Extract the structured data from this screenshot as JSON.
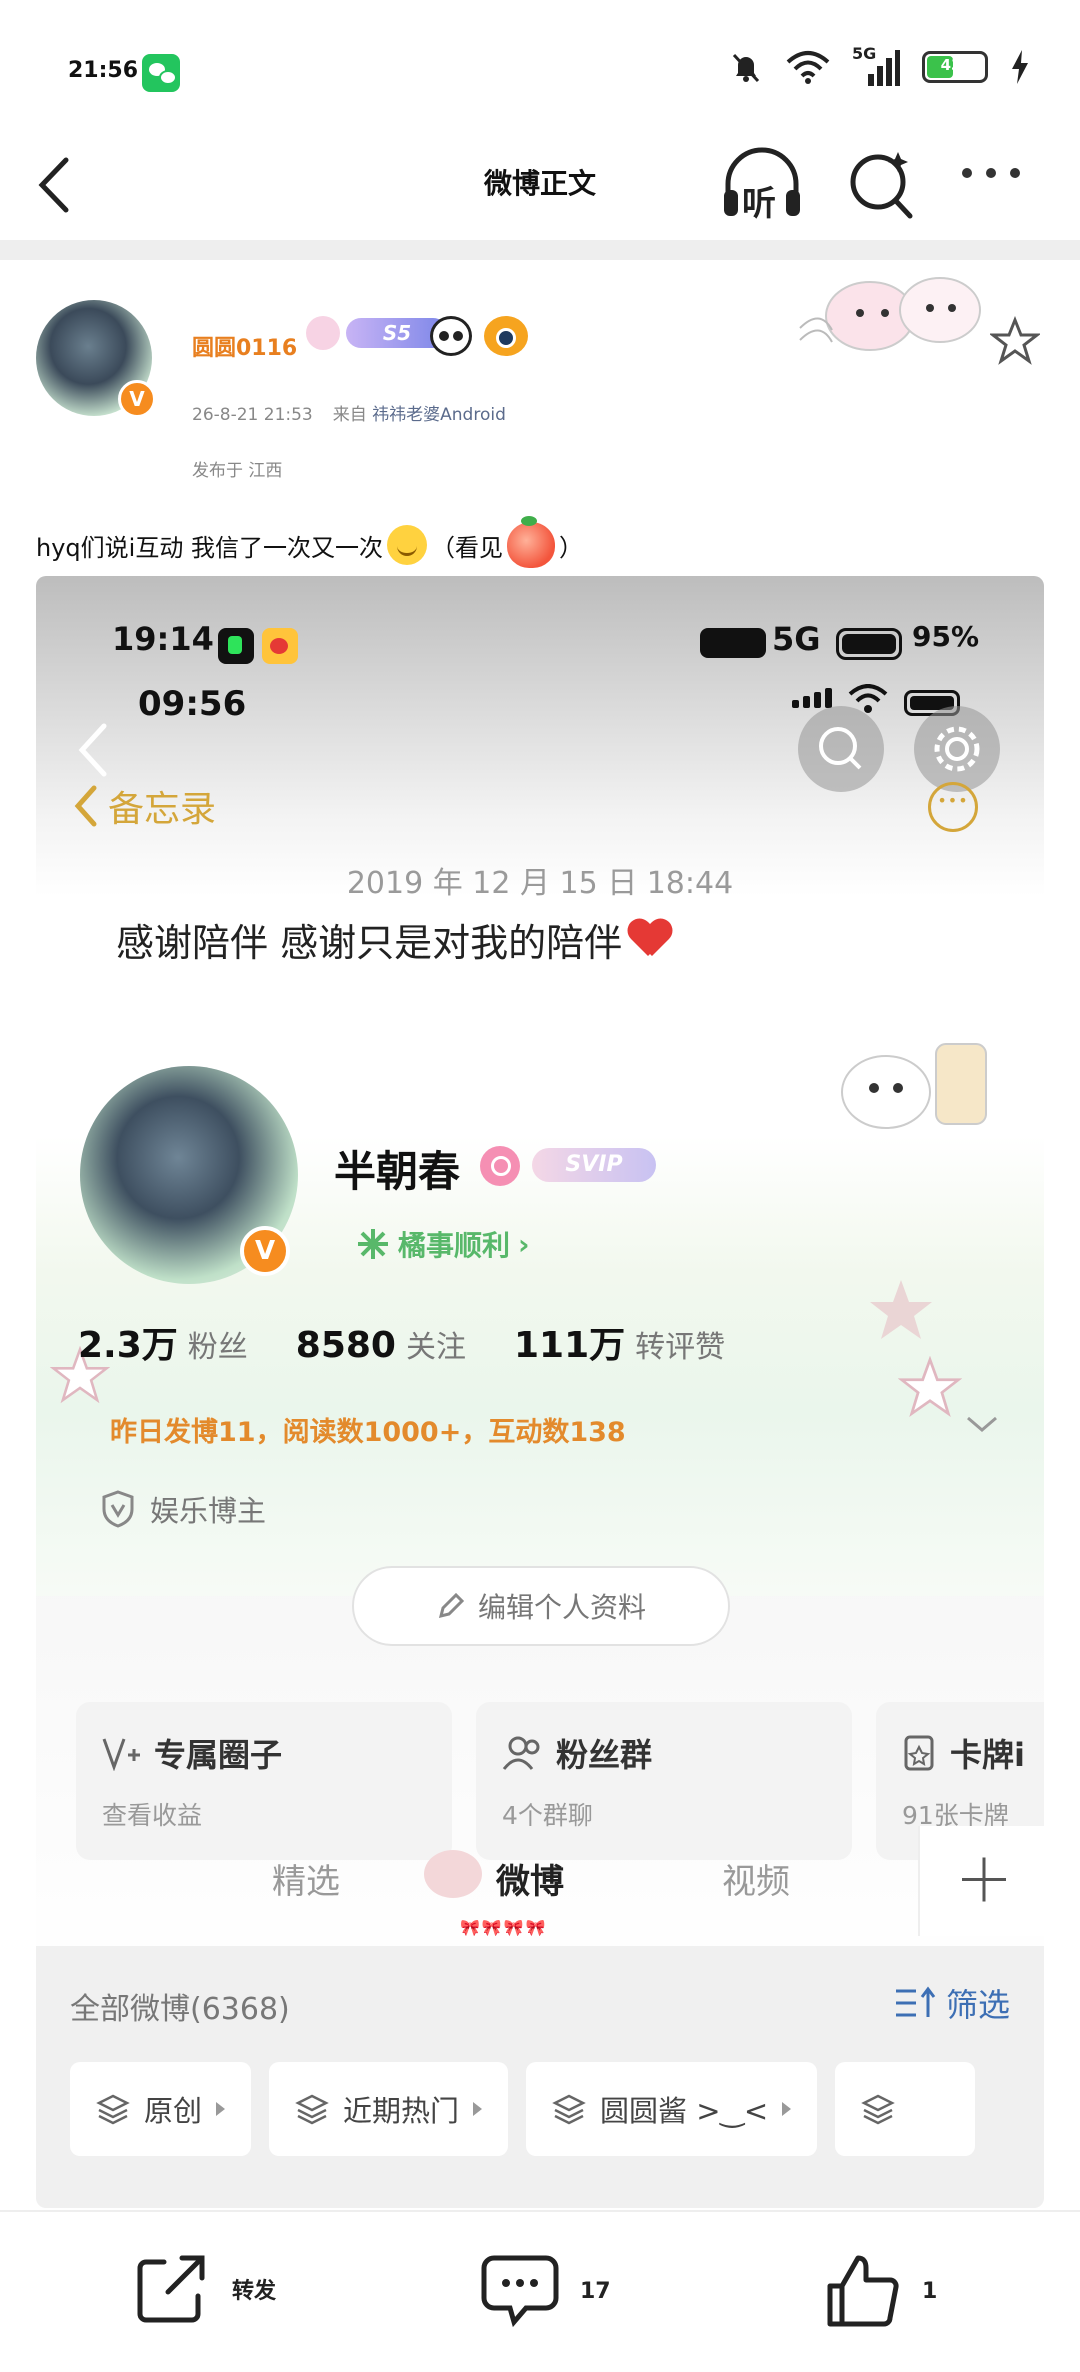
{
  "status_bar": {
    "time": "21:56",
    "battery": "43",
    "battery_level": 0.43,
    "network": "5G"
  },
  "nav": {
    "title": "微博正文",
    "listen_label": "听"
  },
  "post": {
    "username": "圆圆0116",
    "level_badge": "S5",
    "meta_time": "26-8-21 21:53",
    "meta_from_prefix": "来自",
    "meta_source": "祎祎老婆Android",
    "location": "发布于 江西",
    "text_part1": "hyq们说i互动 我信了一次又一次",
    "text_part2": "（看见",
    "text_part3": "）"
  },
  "embedded": {
    "time_top": "19:14",
    "network": "5G",
    "battery_pct": "95%",
    "time_inner": "09:56",
    "memo_back_label": "备忘录",
    "memo_date": "2019 年 12 月 15 日 18:44",
    "memo_text": "感谢陪伴 感谢只是对我的陪伴",
    "profile": {
      "name": "半朝春",
      "svip": "SVIP",
      "subtitle": "橘事顺利",
      "stats": [
        {
          "value": "2.3万",
          "label": "粉丝"
        },
        {
          "value": "8580",
          "label": "关注"
        },
        {
          "value": "111万",
          "label": "转评赞"
        }
      ],
      "activity": "昨日发博11，阅读数1000+，互动数138",
      "category": "娱乐博主",
      "edit_button": "编辑个人资料"
    },
    "cards": [
      {
        "title": "专属圈子",
        "sub": "查看收益"
      },
      {
        "title": "粉丝群",
        "sub": "4个群聊"
      },
      {
        "title": "卡牌i",
        "sub": "91张卡牌"
      }
    ],
    "tabs": [
      "精选",
      "微博",
      "视频"
    ],
    "list_title": "全部微博(6368)",
    "filter_label": "筛选",
    "chips": [
      "原创",
      "近期热门",
      "圆圆酱 >‿<"
    ]
  },
  "toolbar": {
    "repost_label": "转发",
    "comment_count": "17",
    "like_count": "1"
  },
  "colors": {
    "accent_orange": "#f68c1f",
    "link_blue": "#3d6fb4",
    "green": "#58b86a"
  }
}
